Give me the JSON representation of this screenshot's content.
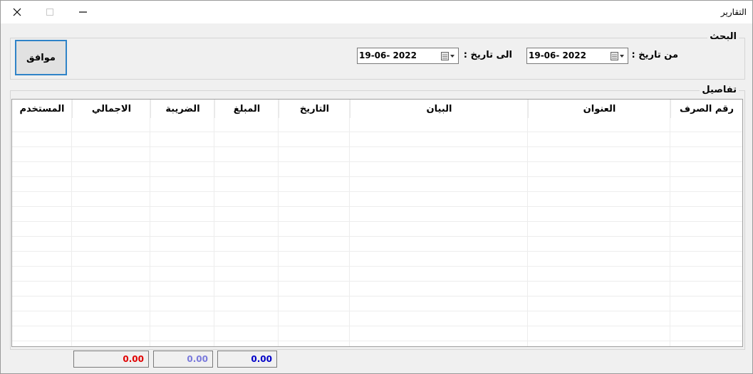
{
  "window": {
    "title": "التقارير",
    "close_glyph": "✕",
    "max_glyph": "☐",
    "min_glyph": "—"
  },
  "search": {
    "legend": "البحث",
    "from_label": "من تاريخ :",
    "from_value": "19-06- 2022",
    "to_label": "الى تاريخ :",
    "to_value": "19-06- 2022",
    "ok_label": "موافق"
  },
  "details": {
    "legend": "تفاصيل",
    "columns": [
      "رقم الصرف",
      "العنوان",
      "البيان",
      "التاريخ",
      "المبلغ",
      "الضريبة",
      "الاجمالي",
      "المستخدم"
    ],
    "rows": []
  },
  "totals": {
    "total": "0.00",
    "tax": "0.00",
    "amount": "0.00",
    "total_color": "#e00000",
    "tax_color": "#7a7adc",
    "amount_color": "#0000c8"
  },
  "icons": {
    "close": "close-icon",
    "maximize": "maximize-icon",
    "minimize": "minimize-icon",
    "calendar": "calendar-icon",
    "dropdown": "chevron-down-icon"
  }
}
